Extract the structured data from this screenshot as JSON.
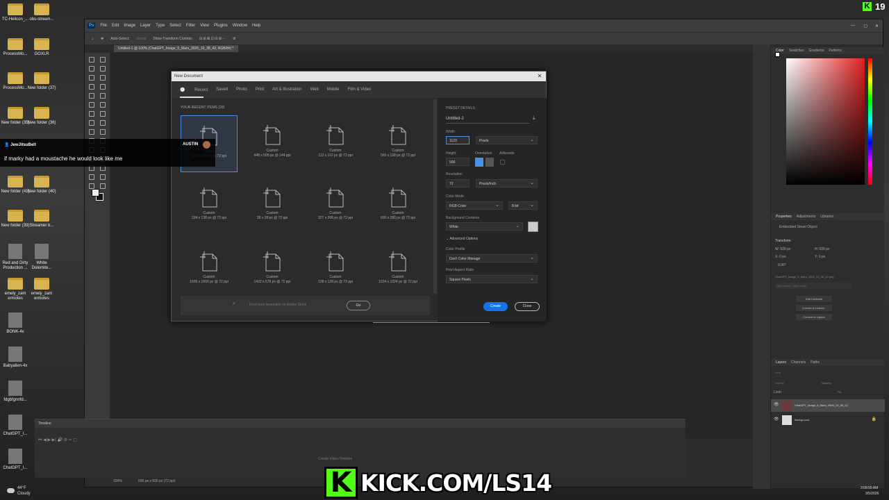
{
  "desktop": {
    "icons": [
      {
        "label": "TC-Helicon_...",
        "kind": "folder"
      },
      {
        "label": "obs-stream...",
        "kind": "folder"
      },
      {
        "label": "ProcessMo...",
        "kind": "folder"
      },
      {
        "label": "GOXLR",
        "kind": "folder"
      },
      {
        "label": "ProcessMo...",
        "kind": "folder"
      },
      {
        "label": "New folder (37)",
        "kind": "folder"
      },
      {
        "label": "New folder (35)",
        "kind": "folder"
      },
      {
        "label": "New folder (36)",
        "kind": "folder"
      },
      {
        "label": "New folder (41)",
        "kind": "folder"
      },
      {
        "label": "New folder (40)",
        "kind": "folder"
      },
      {
        "label": "New folder (39)",
        "kind": "folder"
      },
      {
        "label": "Streamer b...",
        "kind": "folder"
      },
      {
        "label": "Red and Dirty Production ...",
        "kind": "app"
      },
      {
        "label": "White Dolemite...",
        "kind": "app"
      },
      {
        "label": "emely_zam ermotes",
        "kind": "folder"
      },
      {
        "label": "emely_zam ermotes",
        "kind": "folder"
      },
      {
        "label": "BONK-4x",
        "kind": "image"
      },
      {
        "label": "Babyalien-4x",
        "kind": "image"
      },
      {
        "label": "fdgbfgnnfd...",
        "kind": "image"
      },
      {
        "label": "ChatGPT_I...",
        "kind": "image"
      },
      {
        "label": "ChatGPT_I...",
        "kind": "image"
      }
    ],
    "weather": {
      "temp": "44°F",
      "cond": "Cloudy"
    },
    "clock": {
      "time": "3:08:55 AM",
      "date": "3/5/2026"
    }
  },
  "ps": {
    "app_icon": "Ps",
    "menu": [
      "File",
      "Edit",
      "Image",
      "Layer",
      "Type",
      "Select",
      "Filter",
      "View",
      "Plugins",
      "Window",
      "Help"
    ],
    "options": {
      "auto_select": "Auto-Select:",
      "group": "Group",
      "transform": "Show Transform Controls"
    },
    "doc_tab": "Untitled-1 @ 100% (ChatGPT_Image_5_Mars_2026_19_38_42, RGB/8#) *",
    "status": {
      "zoom": "100%",
      "size": "500 px x 500 px (72 ppi)"
    },
    "timeline": {
      "title": "Timeline",
      "create_btn": "Create Video Timeline"
    },
    "color_tabs": [
      "Color",
      "Swatches",
      "Gradients",
      "Patterns"
    ],
    "props_tabs": [
      "Properties",
      "Adjustments",
      "Libraries"
    ],
    "props": {
      "type": "Embedded Smart Object",
      "transform": "Transform",
      "w": "W: 500 px",
      "h": "H: 500 px",
      "x": "X: 0 px",
      "y": "Y: 0 px",
      "angle": "0.00°",
      "file": "ChatGPT_Image_5_Mars_2026_19_38_42.png",
      "layer_comp": "Don't Apply Layer Comp",
      "buttons": [
        "Edit Contents",
        "Convert to Linked...",
        "Convert to Layers"
      ]
    },
    "layers_tabs": [
      "Layers",
      "Channels",
      "Paths"
    ],
    "layers_opts": {
      "kind": "Kind",
      "mode": "Normal",
      "opacity": "Opacity:",
      "lock": "Lock:",
      "fill": "Fill:"
    },
    "layers": [
      {
        "name": "ChatGPT_Image_5_Mars_2026_19_38_42",
        "selected": true
      },
      {
        "name": "Background",
        "selected": false
      }
    ]
  },
  "dialog": {
    "title": "New Document",
    "tabs": [
      "Recent",
      "Saved",
      "Photo",
      "Print",
      "Art & Illustration",
      "Web",
      "Mobile",
      "Film & Video"
    ],
    "active_tab": "Recent",
    "recent_label": "YOUR RECENT ITEMS (20)",
    "items": [
      {
        "name": "Custom",
        "spec": "500 x 500 px @ 72 ppi",
        "selected": true
      },
      {
        "name": "Custom",
        "spec": "448 x 505 px @ 144 ppi"
      },
      {
        "name": "Custom",
        "spec": "112 x 112 px @ 72 ppi"
      },
      {
        "name": "Custom",
        "spec": "560 x 128 px @ 72 ppi"
      },
      {
        "name": "Custom",
        "spec": "234 x 138 px @ 72 ppi"
      },
      {
        "name": "Custom",
        "spec": "28 x 28 px @ 72 ppi"
      },
      {
        "name": "Custom",
        "spec": "327 x 206 px @ 72 ppi"
      },
      {
        "name": "Custom",
        "spec": "600 x 280 px @ 72 ppi"
      },
      {
        "name": "Custom",
        "spec": "1500 x 1500 px @ 72 ppi"
      },
      {
        "name": "Custom",
        "spec": "1422 x 678 px @ 72 ppi"
      },
      {
        "name": "Custom",
        "spec": "128 x 128 px @ 72 ppi"
      },
      {
        "name": "Custom",
        "spec": "1024 x 1024 px @ 72 ppi"
      }
    ],
    "search_placeholder": "Find more templates on Adobe Stock",
    "go": "Go",
    "preset": {
      "header": "PRESET DETAILS",
      "name": "Untitled-2",
      "width_label": "Width",
      "width": "1123",
      "width_unit": "Pixels",
      "height_label": "Height",
      "height": "500",
      "orientation_label": "Orientation",
      "artboards_label": "Artboards",
      "resolution_label": "Resolution",
      "resolution": "72",
      "resolution_unit": "Pixels/Inch",
      "color_mode_label": "Color Mode",
      "color_mode": "RGB Color",
      "bit_depth": "8 bit",
      "bg_label": "Background Contents",
      "bg": "White",
      "advanced": "Advanced Options",
      "profile_label": "Color Profile",
      "profile": "Don't Color Manage",
      "aspect_label": "Pixel Aspect Ratio",
      "aspect": "Square Pixels"
    },
    "create": "Create",
    "close": "Close"
  },
  "chat": {
    "user": "JewJitsuBelt",
    "badge_name": "AUSTIN",
    "message": "if marky had a moustache he would look like me"
  },
  "kick": {
    "banner": "KICK.COM/LS14",
    "badge_count": "19"
  },
  "colors": {
    "accent": "#4a90e2",
    "kick_green": "#53fc18"
  }
}
